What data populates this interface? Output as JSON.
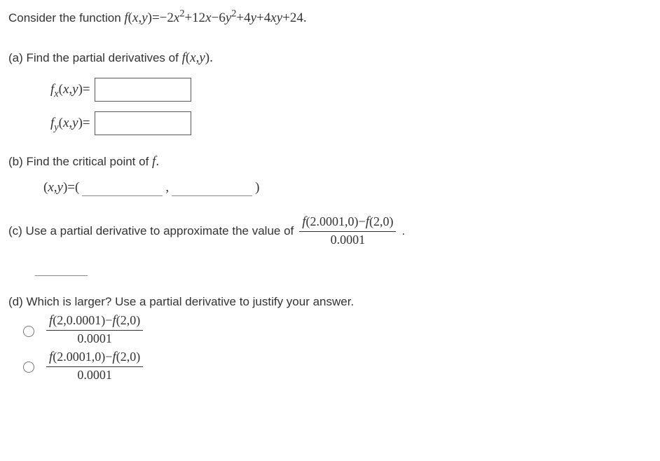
{
  "intro": {
    "prefix": "Consider the function  ",
    "fn": "f",
    "args_open": "(",
    "x": "x",
    "comma": ",",
    "y": "y",
    "args_close": ")",
    "eq": "=",
    "expr_plain": "−2",
    "x2": "x",
    "sq1": "2",
    "plus12x": "+12",
    "x1": "x",
    "minus6": "−6",
    "y2": "y",
    "sq2": "2",
    "plus4y": "+4",
    "y1": "y",
    "plus4xy": "+4",
    "xy_x": "x",
    "xy_y": "y",
    "plus24": "+24."
  },
  "a": {
    "label": "(a) Find the partial derivatives of ",
    "fxy": "f",
    "open": "(",
    "x": "x",
    "comma": ",",
    "y": "y",
    "close": ").",
    "fx_f": "f",
    "fx_sub": "x",
    "fx_open": "(",
    "fx_x": "x",
    "fx_comma": ",",
    "fx_y": "y",
    "fx_close": ")=",
    "fy_f": "f",
    "fy_sub": "y",
    "fy_open": "(",
    "fy_x": "x",
    "fy_comma": ",",
    "fy_y": "y",
    "fy_close": ")="
  },
  "b": {
    "label": "(b) Find the critical point of ",
    "f": "f",
    "dot": ".",
    "open": "(",
    "x": "x",
    "comma": ",",
    "y": "y",
    "close": ")=( ",
    "mid_comma": " , ",
    "end": " )"
  },
  "c": {
    "label": "(c) Use a partial derivative to approximate the value of ",
    "num": "f(2.0001,0)−f(2,0)",
    "den": "0.0001",
    "dot": "."
  },
  "d": {
    "label": "(d) Which is larger? Use a partial derivative to justify your answer.",
    "opt1_num": "f(2,0.0001)−f(2,0)",
    "opt1_den": "0.0001",
    "opt2_num": "f(2.0001,0)−f(2,0)",
    "opt2_den": "0.0001"
  }
}
